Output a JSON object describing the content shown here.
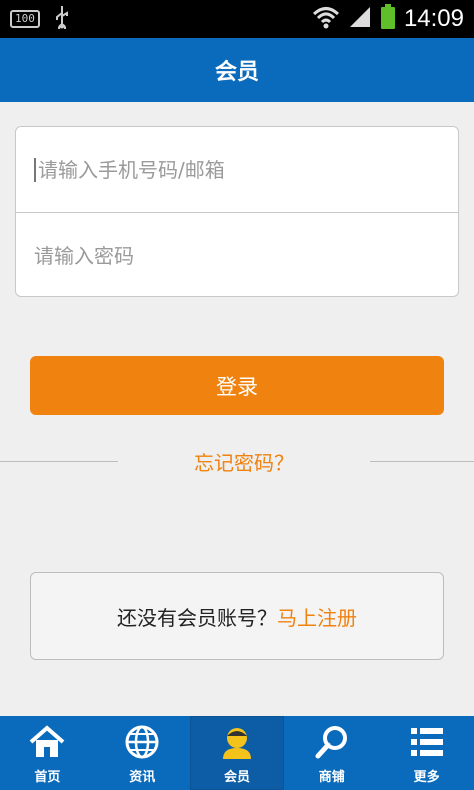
{
  "status_bar": {
    "battery_level": "100",
    "time": "14:09"
  },
  "header": {
    "title": "会员"
  },
  "login_form": {
    "phone_placeholder": "请输入手机号码/邮箱",
    "password_placeholder": "请输入密码",
    "login_label": "登录",
    "forgot_label": "忘记密码？"
  },
  "register": {
    "prompt": "还没有会员账号？",
    "link": "马上注册"
  },
  "bottom_nav": {
    "items": [
      {
        "label": "首页",
        "icon": "home-icon"
      },
      {
        "label": "资讯",
        "icon": "globe-icon"
      },
      {
        "label": "会员",
        "icon": "member-icon"
      },
      {
        "label": "商铺",
        "icon": "search-icon"
      },
      {
        "label": "更多",
        "icon": "list-icon"
      }
    ],
    "active_index": 2
  },
  "colors": {
    "primary": "#0a6bbc",
    "accent": "#f0820f",
    "background": "#efefef"
  }
}
